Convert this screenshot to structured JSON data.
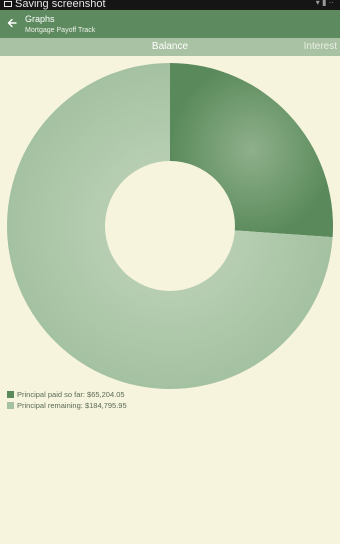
{
  "status_bar": {
    "notification_text": "Saving screenshot"
  },
  "app_bar": {
    "title": "Graphs",
    "subtitle": "Mortgage Payoff Track"
  },
  "tabs": [
    {
      "label": "Balance",
      "selected": true
    },
    {
      "label": "Interest",
      "selected": false
    }
  ],
  "colors": {
    "app_bar": "#5e8a5f",
    "tab_bar": "#a9c2a3",
    "background": "#f6f4dc",
    "principal_paid": "#5a8a5b",
    "principal_remaining": "#a4c1a1"
  },
  "legend": [
    {
      "label": "Principal paid so far: $65,204.05"
    },
    {
      "label": "Principal remaining: $184,795.95"
    }
  ],
  "chart_data": {
    "type": "pie",
    "style": "donut",
    "slices": [
      {
        "label": "Principal paid so far",
        "value": 65204.05
      },
      {
        "label": "Principal remaining",
        "value": 184795.95
      }
    ]
  }
}
